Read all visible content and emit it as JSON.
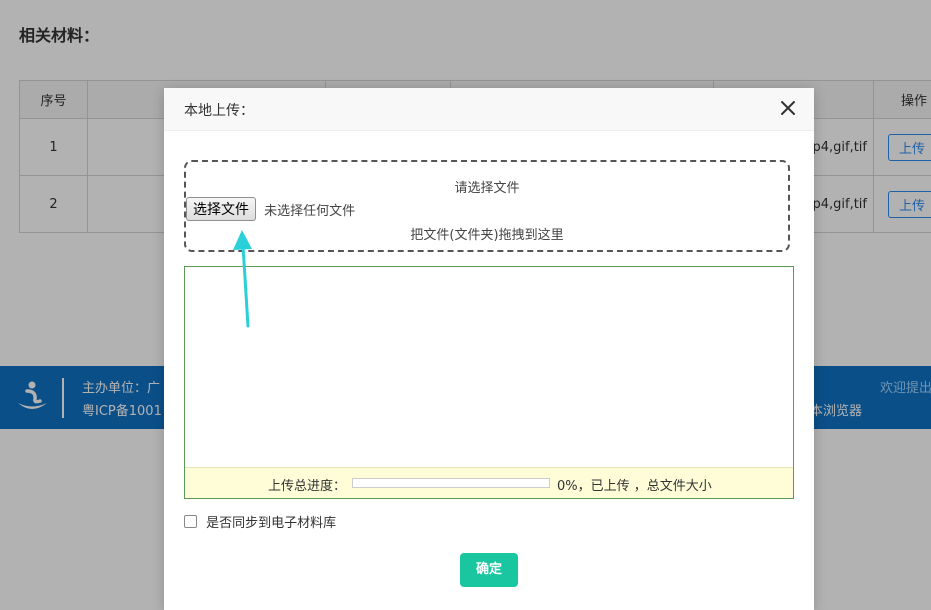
{
  "page": {
    "section_title": "相关材料："
  },
  "table": {
    "headers": [
      "序号",
      "",
      "",
      "",
      "",
      "操作"
    ],
    "rows": [
      {
        "no": "1",
        "types": "p4,gif,tif",
        "action": "上传"
      },
      {
        "no": "2",
        "types": "p4,gif,tif",
        "action": "上传"
      }
    ]
  },
  "footer": {
    "line1": "主办单位：广",
    "line2": "粤ICP备1001",
    "welcome": "欢迎提出",
    "browser": "本浏览器",
    "logo_icon": "org-logo-icon"
  },
  "modal": {
    "title": "本地上传：",
    "close_icon": "close-icon",
    "drop_zone": {
      "prompt": "请选择文件",
      "choose_button": "选择文件",
      "no_file": "未选择任何文件",
      "drag_hint": "把文件(文件夹)拖拽到这里"
    },
    "progress": {
      "label": "上传总进度：",
      "percent_value": 0,
      "status": "0%，已上传 ，总文件大小"
    },
    "sync_checkbox": {
      "label": "是否同步到电子材料库",
      "checked": false
    },
    "confirm_button": "确定"
  },
  "colors": {
    "primary_blue": "#1172c4",
    "confirm_green": "#1ac6a0",
    "arrow_cyan": "#2ad0d8",
    "upload_border_blue": "#2d8cf0"
  }
}
